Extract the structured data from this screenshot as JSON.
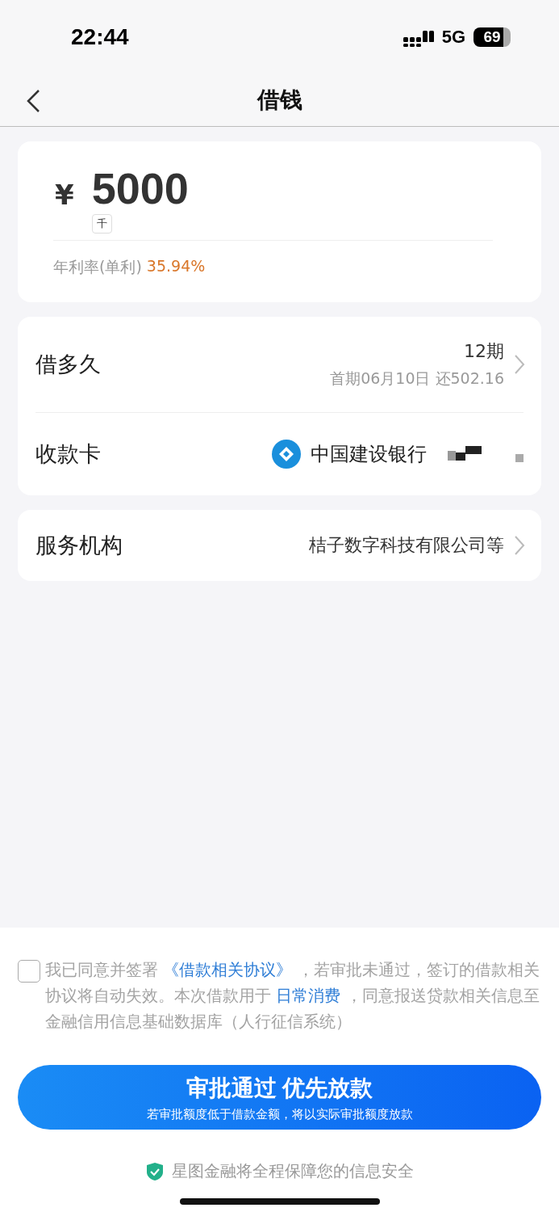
{
  "status_bar": {
    "time": "22:44",
    "network": "5G",
    "battery": "69"
  },
  "nav": {
    "title": "借钱"
  },
  "amount": {
    "currency": "¥",
    "value": "5000",
    "unit_hint": "千",
    "rate_label": "年利率(单利)",
    "rate_value": "35.94%"
  },
  "term": {
    "label": "借多久",
    "value": "12期",
    "detail": "首期06月10日 还502.16"
  },
  "card": {
    "label": "收款卡",
    "bank": "中国建设银行"
  },
  "institution": {
    "label": "服务机构",
    "value": "桔子数字科技有限公司等"
  },
  "agreement": {
    "checked": false,
    "parts": [
      {
        "kind": "text",
        "text": "我已同意并签署 "
      },
      {
        "kind": "link",
        "text": "《借款相关协议》"
      },
      {
        "kind": "text",
        "text": " ，若审批未通过，签订的借款相关协议将自动失效。本次借款用于 "
      },
      {
        "kind": "link",
        "text": "日常消费"
      },
      {
        "kind": "text",
        "text": " ，同意报送贷款相关信息至金融信用信息基础数据库（人行征信系统）"
      }
    ]
  },
  "submit": {
    "title": "审批通过 优先放款",
    "subtitle": "若审批额度低于借款金额，将以实际审批额度放款"
  },
  "footer": {
    "text": "星图金融将全程保障您的信息安全"
  }
}
